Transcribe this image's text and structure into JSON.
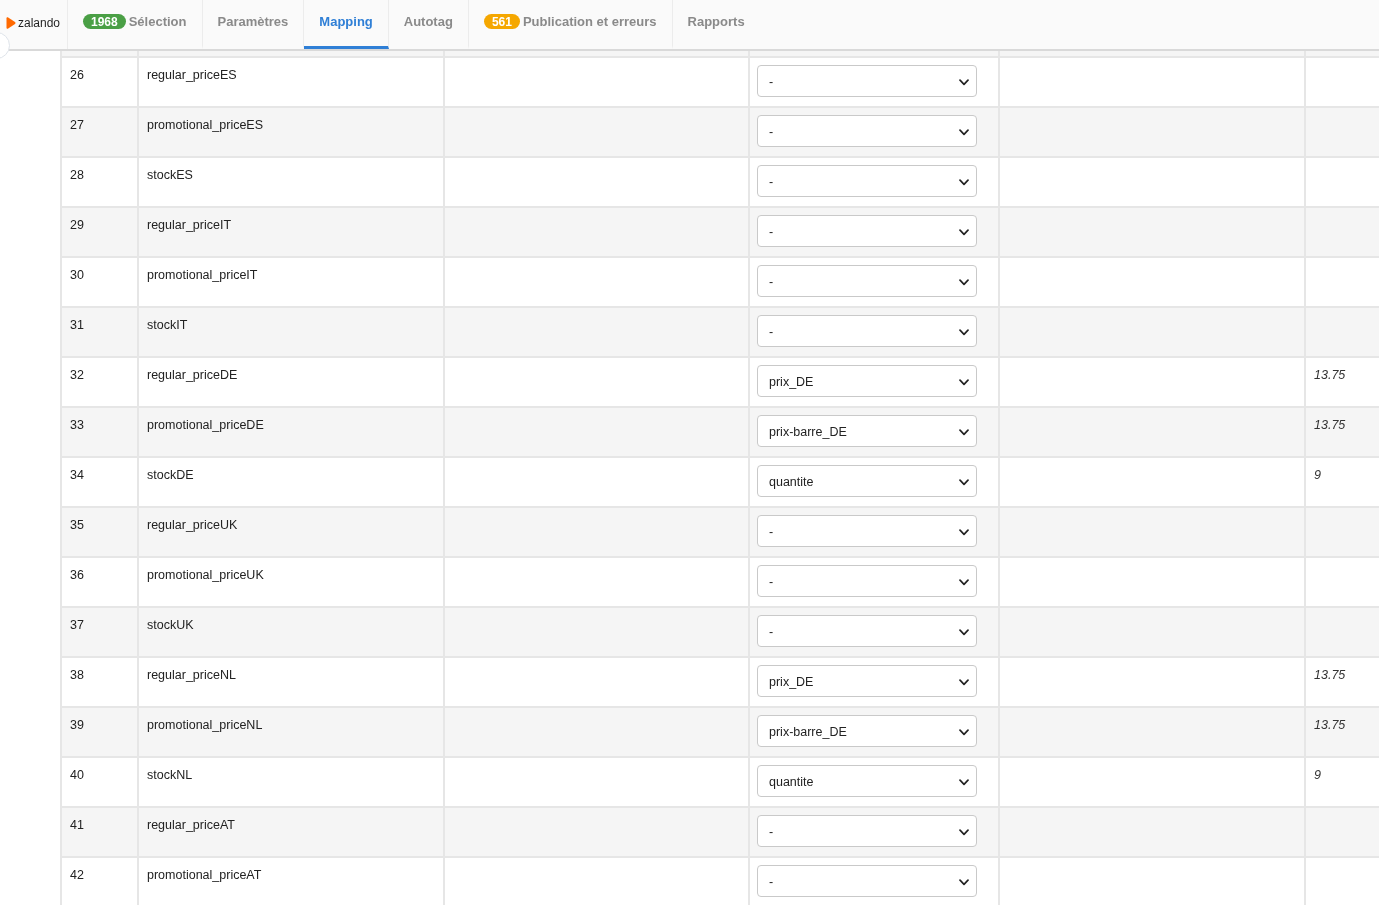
{
  "brand": {
    "name": "zalando"
  },
  "tabs": [
    {
      "label": "Sélection",
      "badge": {
        "text": "1968",
        "color": "#4a9f45"
      },
      "selected": false
    },
    {
      "label": "Paramètres",
      "selected": false
    },
    {
      "label": "Mapping",
      "selected": true
    },
    {
      "label": "Autotag",
      "selected": false
    },
    {
      "label": "Publication et erreurs",
      "badge": {
        "text": "561",
        "color": "#f5a700"
      },
      "selected": false
    },
    {
      "label": "Rapports",
      "selected": false
    }
  ],
  "table": {
    "rows": [
      {
        "number": "26",
        "field": "regular_priceES",
        "mapping": "-"
      },
      {
        "number": "27",
        "field": "promotional_priceES",
        "mapping": "-"
      },
      {
        "number": "28",
        "field": "stockES",
        "mapping": "-"
      },
      {
        "number": "29",
        "field": "regular_priceIT",
        "mapping": "-"
      },
      {
        "number": "30",
        "field": "promotional_priceIT",
        "mapping": "-"
      },
      {
        "number": "31",
        "field": "stockIT",
        "mapping": "-"
      },
      {
        "number": "32",
        "field": "regular_priceDE",
        "mapping": "prix_DE",
        "value": "13.75"
      },
      {
        "number": "33",
        "field": "promotional_priceDE",
        "mapping": "prix-barre_DE",
        "value": "13.75"
      },
      {
        "number": "34",
        "field": "stockDE",
        "mapping": "quantite",
        "value": "9"
      },
      {
        "number": "35",
        "field": "regular_priceUK",
        "mapping": "-"
      },
      {
        "number": "36",
        "field": "promotional_priceUK",
        "mapping": "-"
      },
      {
        "number": "37",
        "field": "stockUK",
        "mapping": "-"
      },
      {
        "number": "38",
        "field": "regular_priceNL",
        "mapping": "prix_DE",
        "value": "13.75"
      },
      {
        "number": "39",
        "field": "promotional_priceNL",
        "mapping": "prix-barre_DE",
        "value": "13.75"
      },
      {
        "number": "40",
        "field": "stockNL",
        "mapping": "quantite",
        "value": "9"
      },
      {
        "number": "41",
        "field": "regular_priceAT",
        "mapping": "-"
      },
      {
        "number": "42",
        "field": "promotional_priceAT",
        "mapping": "-"
      }
    ]
  }
}
